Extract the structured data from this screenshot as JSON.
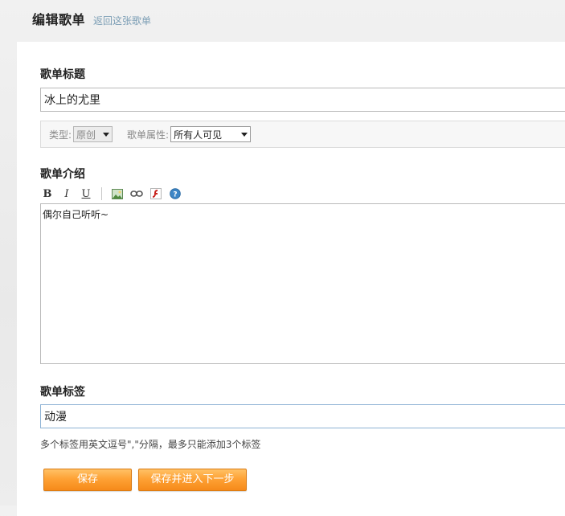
{
  "header": {
    "title": "编辑歌单",
    "back_link": "返回这张歌单"
  },
  "form": {
    "title_label": "歌单标题",
    "title_value": "冰上的尤里",
    "type_label": "类型:",
    "type_value": "原创",
    "attr_label": "歌单属性:",
    "attr_value": "所有人可见",
    "intro_label": "歌单介绍",
    "intro_value": "偶尔自己听听~",
    "tags_label": "歌单标签",
    "tags_value": "动漫",
    "tags_hint": "多个标签用英文逗号\",\"分隔，最多只能添加3个标签"
  },
  "toolbar": {
    "bold": "B",
    "italic": "I",
    "underline": "U",
    "icons": [
      "bold-icon",
      "italic-icon",
      "underline-icon",
      "image-icon",
      "link-icon",
      "flash-icon",
      "help-icon"
    ]
  },
  "buttons": {
    "save": "保存",
    "save_next": "保存并进入下一步"
  },
  "colors": {
    "button_orange": "#f99a2a",
    "back_link": "#7c9eb5"
  }
}
